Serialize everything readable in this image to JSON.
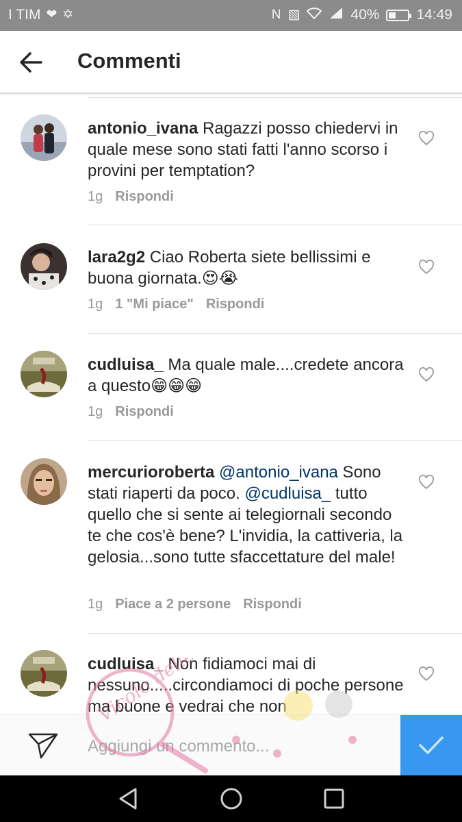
{
  "status_bar": {
    "carrier": "I TIM",
    "battery_text": "40%",
    "battery_level": 0.4,
    "time": "14:49"
  },
  "header": {
    "title": "Commenti"
  },
  "comments": [
    {
      "username": "antonio_ivana",
      "text": " Ragazzi posso chiedervi in quale mese sono stati fatti l'anno scorso i provini per temptation?",
      "time": "1g",
      "likes": "",
      "reply": "Rispondi"
    },
    {
      "username": "lara2g2",
      "text": " Ciao Roberta siete bellissimi e buona giornata.😍😭",
      "time": "1g",
      "likes": "1 \"Mi piace\"",
      "reply": "Rispondi"
    },
    {
      "username": "cudluisa_",
      "text": " Ma quale male....credete ancora a questo😁😁😁",
      "time": "1g",
      "likes": "",
      "reply": "Rispondi"
    },
    {
      "username": "mercurioroberta",
      "mention1": " @antonio_ivana",
      "text1": " Sono stati riaperti da poco. ",
      "mention2": "@cudluisa_",
      "text2": " tutto quello che si sente ai telegiornali secondo te che cos'è bene? L'invidia, la cattiveria, la gelosia...sono tutte sfaccettature del male!",
      "time": "1g",
      "likes": "Piace a 2 persone",
      "reply": "Rispondi"
    },
    {
      "username": "cudluisa_",
      "text": " Non fidiamoci mai di nessuno.....circondiamoci di poche persone ma buone e vedrai che non"
    }
  ],
  "input": {
    "placeholder": "Aggiungi un commento..."
  },
  "watermark_text": "Vicolo delle News",
  "colors": {
    "accent": "#3897f0",
    "mention": "#003569",
    "meta": "#999999",
    "status_bar": "#8b8b8b"
  },
  "icons": [
    "back-arrow-icon",
    "heart-icon",
    "send-icon",
    "checkmark-icon",
    "nav-back-icon",
    "nav-home-icon",
    "nav-recents-icon"
  ]
}
